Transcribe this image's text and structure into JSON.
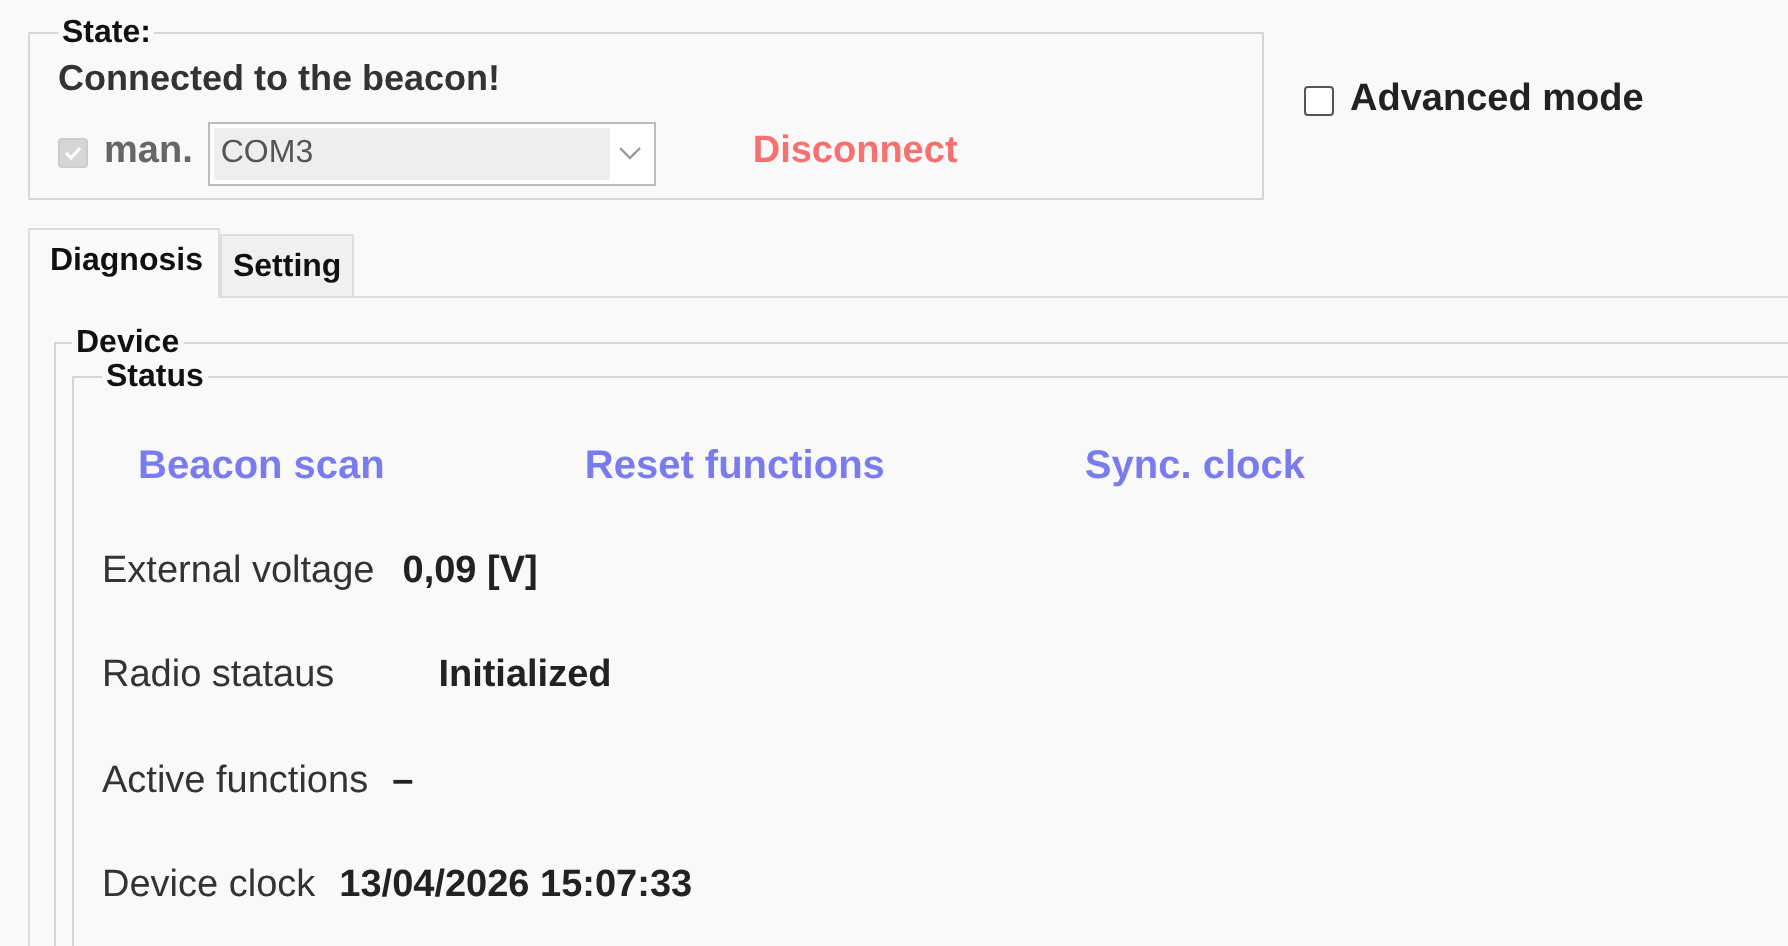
{
  "state_group": {
    "legend": "State:",
    "message": "Connected to the beacon!",
    "manual": {
      "label": "man.",
      "checked": true,
      "disabled": true
    },
    "port": {
      "value": "COM3",
      "disabled": true
    },
    "disconnect": "Disconnect"
  },
  "advanced_mode": {
    "label": "Advanced mode",
    "checked": false
  },
  "tabs": [
    {
      "label": "Diagnosis",
      "selected": true
    },
    {
      "label": "Setting",
      "selected": false
    }
  ],
  "device_group": {
    "legend": "Device",
    "status_group": {
      "legend": "Status",
      "actions": [
        "Beacon scan",
        "Reset functions",
        "Sync. clock"
      ],
      "fields": [
        {
          "label": "External voltage",
          "value": "0,09 [V]"
        },
        {
          "label": "Radio stataus",
          "value": "Initialized"
        },
        {
          "label": "Active functions",
          "value": "–"
        },
        {
          "label": "Device clock",
          "value": "13/04/2026 15:07:33"
        }
      ]
    }
  }
}
